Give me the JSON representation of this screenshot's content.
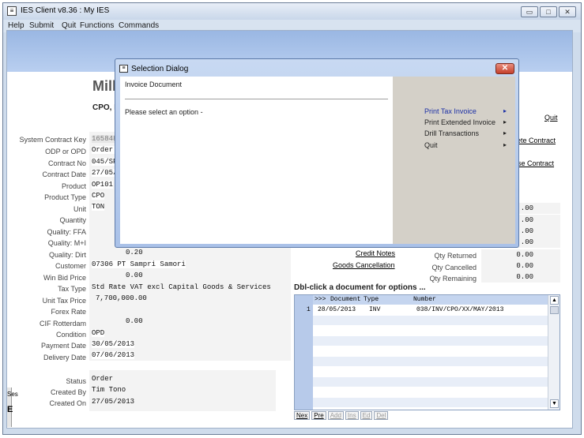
{
  "window": {
    "title": "IES Client v8.36 : My IES",
    "icon_glyph": "≡",
    "buttons": {
      "minimize": "▭",
      "maximize": "□",
      "close": "✕"
    }
  },
  "menu": [
    "Help",
    "Submit",
    "Quit",
    "Functions",
    "Commands"
  ],
  "heading": {
    "big": "Mill",
    "sub": "CPO, I"
  },
  "fields": [
    {
      "label": "System Contract Key",
      "value": "165848"
    },
    {
      "label": "ODP or OPD",
      "value": "Order."
    },
    {
      "label": "Contract No",
      "value": "045/SP"
    },
    {
      "label": "Contract Date",
      "value": "27/05/"
    },
    {
      "label": "Product",
      "value": "OP101"
    },
    {
      "label": "Product Type",
      "value": "CPO"
    },
    {
      "label": "Unit",
      "value": "TON"
    },
    {
      "label": "Quantity",
      "value": ""
    },
    {
      "label": "Quality: FFA",
      "value": ""
    },
    {
      "label": "Quality: M+I",
      "value": ""
    },
    {
      "label": "Quality: Dirt",
      "value": "0.20"
    },
    {
      "label": "Customer",
      "value": "07306 PT Sampri Samori"
    },
    {
      "label": "Win Bid Price",
      "value": "0.00"
    },
    {
      "label": "Tax Type",
      "value": "Std Rate VAT excl Capital Goods & Services"
    },
    {
      "label": "Unit Tax Price",
      "value": "7,700,000.00"
    },
    {
      "label": "Forex Rate",
      "value": ""
    },
    {
      "label": "CIF Rotterdam",
      "value": "0.00"
    },
    {
      "label": "Condition",
      "value": "OPD"
    },
    {
      "label": "Payment Date",
      "value": "30/05/2013"
    },
    {
      "label": "Delivery Date",
      "value": "07/06/2013"
    }
  ],
  "status_fields": [
    {
      "label": "Status",
      "value": "Order"
    },
    {
      "label": "Created By",
      "value": "Tim Tono"
    },
    {
      "label": "Created On",
      "value": "27/05/2013"
    }
  ],
  "right_links": {
    "quit": "Quit",
    "delete_contract": "ete Contract",
    "close_contract": "se Contract",
    "credit_notes": "Credit Notes",
    "goods_cancellation": "Goods Cancellation"
  },
  "right_numbers": [
    {
      "label": "",
      "value": ".00"
    },
    {
      "label": "",
      "value": ".00"
    },
    {
      "label": "",
      "value": ".00"
    },
    {
      "label": "",
      "value": ".00"
    },
    {
      "label": "Qty Returned",
      "value": "0.00"
    },
    {
      "label": "Qty Cancelled",
      "value": "0.00"
    },
    {
      "label": "Qty Remaining",
      "value": "0.00"
    }
  ],
  "grid": {
    "title": "Dbl-click a document for options ...",
    "headers": {
      "marker": ">>>",
      "document": "Document",
      "type": "Type",
      "number": "Number"
    },
    "rows": [
      {
        "index": "1",
        "document": "28/05/2013",
        "type": "INV",
        "number": "038/INV/CPO/XX/MAY/2013"
      }
    ],
    "buttons": [
      "Nex",
      "Pre",
      "Add",
      "Ins",
      "Ed",
      "Del"
    ]
  },
  "left_stub": {
    "text1": "Ses",
    "text2": "E"
  },
  "dialog": {
    "title": "Selection Dialog",
    "document_label": "Invoice Document",
    "prompt": "Please select an option -",
    "options": [
      "Print Tax Invoice",
      "Print Extended Invoice",
      "Drill Transactions",
      "Quit"
    ],
    "arrow": "▸",
    "close": "✕"
  },
  "colors": {
    "title_band": "#9ab7e3",
    "highlight_option": "#1b2fa6",
    "close_button": "#c4402c"
  }
}
